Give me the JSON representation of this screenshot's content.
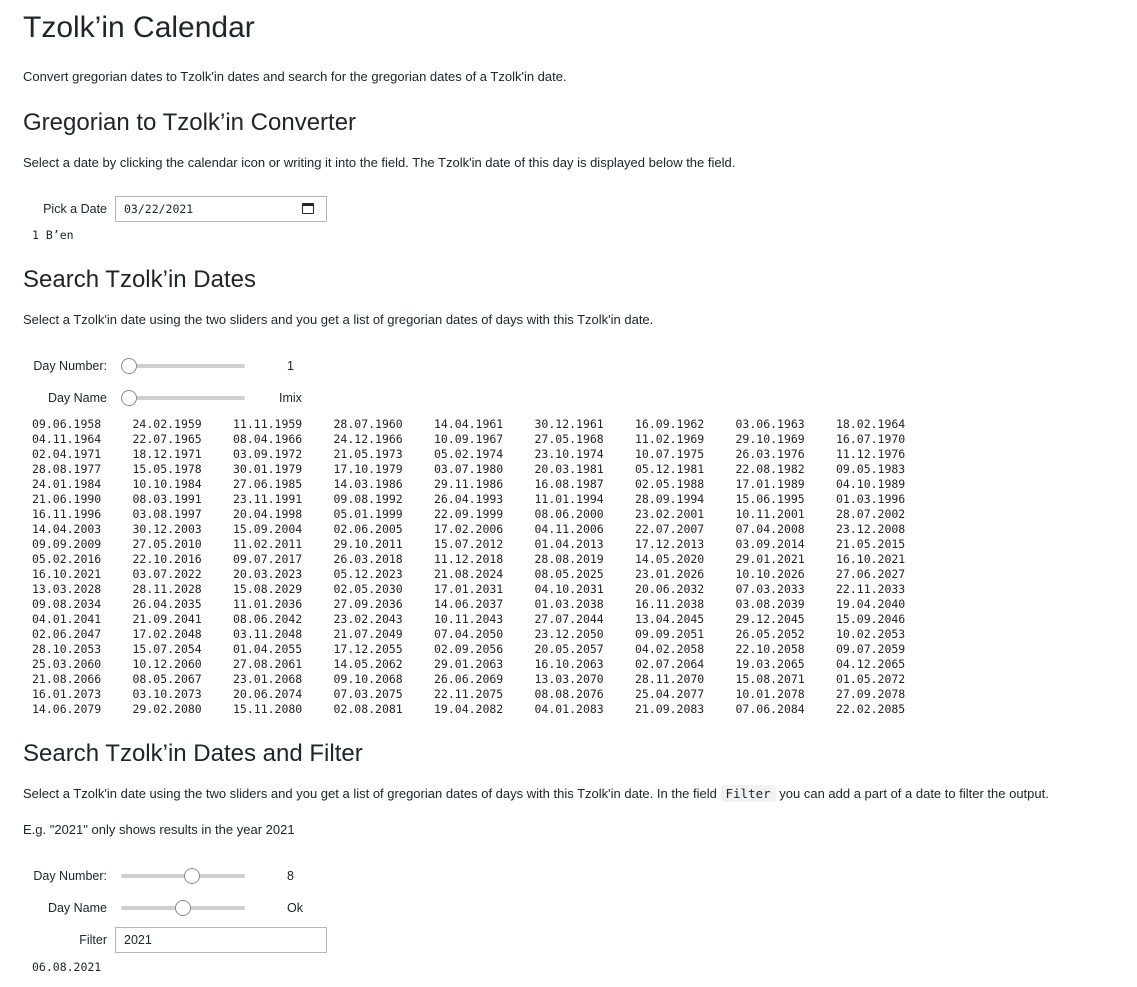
{
  "page": {
    "title": "Tzolk’in Calendar",
    "intro": "Convert gregorian dates to Tzolk'in dates and search for the gregorian dates of a Tzolk'in date."
  },
  "converter": {
    "heading": "Gregorian to Tzolk’in Converter",
    "description": "Select a date by clicking the calendar icon or writing it into the field. The Tzolk'in date of this day is displayed below the field.",
    "date_label": "Pick a Date",
    "date_value": "03/22/2021",
    "result": "1 B’en"
  },
  "search": {
    "heading": "Search Tzolk’in Dates",
    "description": "Select a Tzolk'in date using the two sliders and you get a list of gregorian dates of days with this Tzolk'in date.",
    "day_number_label": "Day Number:",
    "day_number_value": "1",
    "day_number_position": 0.0,
    "day_name_label": "Day Name",
    "day_name_value": "Imix",
    "day_name_position": 0.0,
    "results": [
      [
        "09.06.1958",
        "24.02.1959",
        "11.11.1959",
        "28.07.1960",
        "14.04.1961",
        "30.12.1961",
        "16.09.1962",
        "03.06.1963",
        "18.02.1964"
      ],
      [
        "04.11.1964",
        "22.07.1965",
        "08.04.1966",
        "24.12.1966",
        "10.09.1967",
        "27.05.1968",
        "11.02.1969",
        "29.10.1969",
        "16.07.1970"
      ],
      [
        "02.04.1971",
        "18.12.1971",
        "03.09.1972",
        "21.05.1973",
        "05.02.1974",
        "23.10.1974",
        "10.07.1975",
        "26.03.1976",
        "11.12.1976"
      ],
      [
        "28.08.1977",
        "15.05.1978",
        "30.01.1979",
        "17.10.1979",
        "03.07.1980",
        "20.03.1981",
        "05.12.1981",
        "22.08.1982",
        "09.05.1983"
      ],
      [
        "24.01.1984",
        "10.10.1984",
        "27.06.1985",
        "14.03.1986",
        "29.11.1986",
        "16.08.1987",
        "02.05.1988",
        "17.01.1989",
        "04.10.1989"
      ],
      [
        "21.06.1990",
        "08.03.1991",
        "23.11.1991",
        "09.08.1992",
        "26.04.1993",
        "11.01.1994",
        "28.09.1994",
        "15.06.1995",
        "01.03.1996"
      ],
      [
        "16.11.1996",
        "03.08.1997",
        "20.04.1998",
        "05.01.1999",
        "22.09.1999",
        "08.06.2000",
        "23.02.2001",
        "10.11.2001",
        "28.07.2002"
      ],
      [
        "14.04.2003",
        "30.12.2003",
        "15.09.2004",
        "02.06.2005",
        "17.02.2006",
        "04.11.2006",
        "22.07.2007",
        "07.04.2008",
        "23.12.2008"
      ],
      [
        "09.09.2009",
        "27.05.2010",
        "11.02.2011",
        "29.10.2011",
        "15.07.2012",
        "01.04.2013",
        "17.12.2013",
        "03.09.2014",
        "21.05.2015"
      ],
      [
        "05.02.2016",
        "22.10.2016",
        "09.07.2017",
        "26.03.2018",
        "11.12.2018",
        "28.08.2019",
        "14.05.2020",
        "29.01.2021",
        "16.10.2021"
      ],
      [
        "16.10.2021",
        "03.07.2022",
        "20.03.2023",
        "05.12.2023",
        "21.08.2024",
        "08.05.2025",
        "23.01.2026",
        "10.10.2026",
        "27.06.2027"
      ],
      [
        "13.03.2028",
        "28.11.2028",
        "15.08.2029",
        "02.05.2030",
        "17.01.2031",
        "04.10.2031",
        "20.06.2032",
        "07.03.2033",
        "22.11.2033"
      ],
      [
        "09.08.2034",
        "26.04.2035",
        "11.01.2036",
        "27.09.2036",
        "14.06.2037",
        "01.03.2038",
        "16.11.2038",
        "03.08.2039",
        "19.04.2040"
      ],
      [
        "04.01.2041",
        "21.09.2041",
        "08.06.2042",
        "23.02.2043",
        "10.11.2043",
        "27.07.2044",
        "13.04.2045",
        "29.12.2045",
        "15.09.2046"
      ],
      [
        "02.06.2047",
        "17.02.2048",
        "03.11.2048",
        "21.07.2049",
        "07.04.2050",
        "23.12.2050",
        "09.09.2051",
        "26.05.2052",
        "10.02.2053"
      ],
      [
        "28.10.2053",
        "15.07.2054",
        "01.04.2055",
        "17.12.2055",
        "02.09.2056",
        "20.05.2057",
        "04.02.2058",
        "22.10.2058",
        "09.07.2059"
      ],
      [
        "25.03.2060",
        "10.12.2060",
        "27.08.2061",
        "14.05.2062",
        "29.01.2063",
        "16.10.2063",
        "02.07.2064",
        "19.03.2065",
        "04.12.2065"
      ],
      [
        "21.08.2066",
        "08.05.2067",
        "23.01.2068",
        "09.10.2068",
        "26.06.2069",
        "13.03.2070",
        "28.11.2070",
        "15.08.2071",
        "01.05.2072"
      ],
      [
        "16.01.2073",
        "03.10.2073",
        "20.06.2074",
        "07.03.2075",
        "22.11.2075",
        "08.08.2076",
        "25.04.2077",
        "10.01.2078",
        "27.09.2078"
      ],
      [
        "14.06.2079",
        "29.02.2080",
        "15.11.2080",
        "02.08.2081",
        "19.04.2082",
        "04.01.2083",
        "21.09.2083",
        "07.06.2084",
        "22.02.2085"
      ]
    ]
  },
  "filter_search": {
    "heading": "Search Tzolk’in Dates and Filter",
    "description_before": "Select a Tzolk'in date using the two sliders and you get a list of gregorian dates of days with this Tzolk'in date. In the field ",
    "filter_code": "Filter",
    "description_after": " you can add a part of a date to filter the output.",
    "example": "E.g. \"2021\" only shows results in the year 2021",
    "day_number_label": "Day Number:",
    "day_number_value": "8",
    "day_number_position": 0.583,
    "day_name_label": "Day Name",
    "day_name_value": "Ok",
    "day_name_position": 0.5,
    "filter_label": "Filter",
    "filter_value": "2021",
    "result": "06.08.2021"
  }
}
